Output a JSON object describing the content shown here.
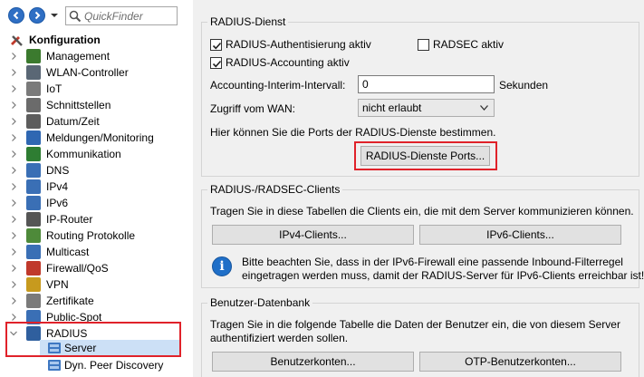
{
  "quickfinder": {
    "placeholder": "QuickFinder"
  },
  "tree": {
    "root_label": "Konfiguration",
    "items": [
      {
        "label": "Management",
        "icon": "management-icon",
        "color": "#3b7a2e"
      },
      {
        "label": "WLAN-Controller",
        "icon": "wlan-controller-icon",
        "color": "#5a6775"
      },
      {
        "label": "IoT",
        "icon": "iot-icon",
        "color": "#7a7a7a"
      },
      {
        "label": "Schnittstellen",
        "icon": "interfaces-icon",
        "color": "#6b6b6b"
      },
      {
        "label": "Datum/Zeit",
        "icon": "clock-icon",
        "color": "#5d5d5d"
      },
      {
        "label": "Meldungen/Monitoring",
        "icon": "monitoring-icon",
        "color": "#2f67b2"
      },
      {
        "label": "Kommunikation",
        "icon": "communication-icon",
        "color": "#2e7d32"
      },
      {
        "label": "DNS",
        "icon": "dns-icon",
        "color": "#3a6fb5"
      },
      {
        "label": "IPv4",
        "icon": "ipv4-icon",
        "color": "#3a6fb5"
      },
      {
        "label": "IPv6",
        "icon": "ipv6-icon",
        "color": "#3a6fb5"
      },
      {
        "label": "IP-Router",
        "icon": "router-icon",
        "color": "#555555"
      },
      {
        "label": "Routing Protokolle",
        "icon": "routing-protocols-icon",
        "color": "#4e8a3a"
      },
      {
        "label": "Multicast",
        "icon": "multicast-icon",
        "color": "#3a6fb5"
      },
      {
        "label": "Firewall/QoS",
        "icon": "firewall-icon",
        "color": "#c0392b"
      },
      {
        "label": "VPN",
        "icon": "vpn-icon",
        "color": "#c79a1e"
      },
      {
        "label": "Zertifikate",
        "icon": "certificate-icon",
        "color": "#7a7a7a"
      },
      {
        "label": "Public-Spot",
        "icon": "public-spot-icon",
        "color": "#3a6fb5"
      },
      {
        "label": "RADIUS",
        "icon": "radius-icon",
        "color": "#2f5f9e"
      }
    ],
    "sub_server": "Server",
    "sub_dyn": "Dyn. Peer Discovery"
  },
  "radius_dienst": {
    "title": "RADIUS-Dienst",
    "auth_label": "RADIUS-Authentisierung aktiv",
    "auth_checked": true,
    "radsec_label": "RADSEC aktiv",
    "radsec_checked": false,
    "accounting_label": "RADIUS-Accounting aktiv",
    "accounting_checked": true,
    "interim_label": "Accounting-Interim-Intervall:",
    "interim_value": "0",
    "interim_unit": "Sekunden",
    "wan_label": "Zugriff vom WAN:",
    "wan_value": "nicht erlaubt",
    "ports_text": "Hier können Sie die Ports der RADIUS-Dienste bestimmen.",
    "ports_button": "RADIUS-Dienste Ports..."
  },
  "clients": {
    "title": "RADIUS-/RADSEC-Clients",
    "text": "Tragen Sie in diese Tabellen die Clients ein, die mit dem Server kommunizieren können.",
    "ipv4_button": "IPv4-Clients...",
    "ipv6_button": "IPv6-Clients...",
    "note_line1": "Bitte beachten Sie, dass in der IPv6-Firewall eine passende Inbound-Filterregel",
    "note_line2": "eingetragen werden muss, damit der RADIUS-Server für IPv6-Clients erreichbar ist!"
  },
  "userdb": {
    "title": "Benutzer-Datenbank",
    "text_line1": "Tragen Sie in die folgende Tabelle die Daten der Benutzer ein, die von diesem Server",
    "text_line2": "authentifiziert werden sollen.",
    "users_button": "Benutzerkonten...",
    "otp_button": "OTP-Benutzerkonten..."
  },
  "colors": {
    "highlight": "#e0222a",
    "selection": "#cce0f6",
    "pane": "#f0f0f0"
  }
}
